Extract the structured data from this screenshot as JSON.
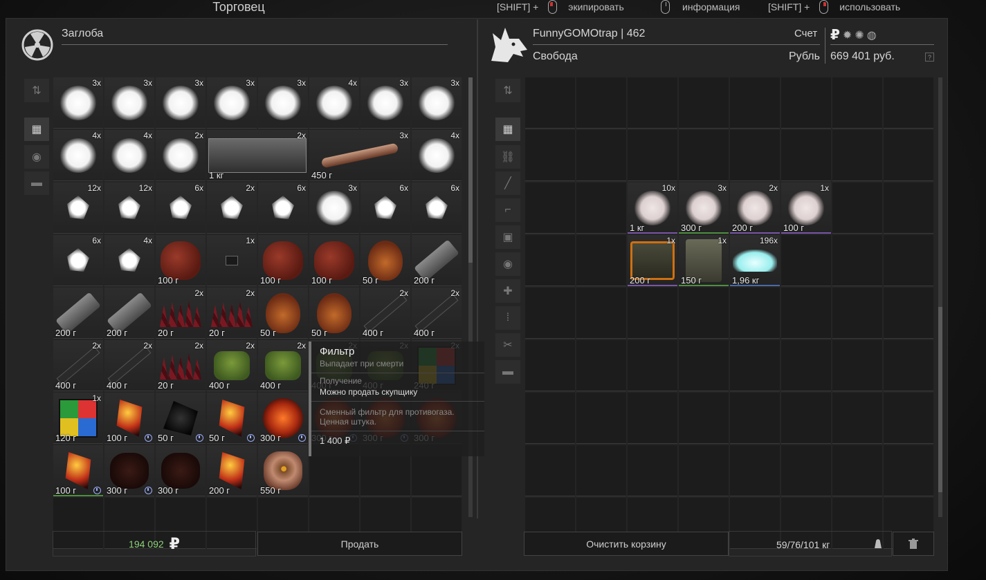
{
  "header": {
    "title": "Торговец",
    "hints": [
      {
        "modifier": "[SHIFT] +",
        "mouse": "left",
        "action": "экипировать"
      },
      {
        "modifier": "",
        "mouse": "plain",
        "action": "информация"
      },
      {
        "modifier": "[SHIFT] +",
        "mouse": "right",
        "action": "использовать"
      }
    ]
  },
  "trader": {
    "name": "Заглоба",
    "icon": "radiation-icon",
    "total": "194 092",
    "currency_symbol": "₽",
    "sell_label": "Продать",
    "tabs": [
      {
        "icon": "sort-icon",
        "glyph": "⇅"
      },
      {
        "icon": "grid-icon",
        "glyph": "▦"
      },
      {
        "icon": "artifact-icon",
        "glyph": "◉"
      },
      {
        "icon": "box-icon",
        "glyph": "▬"
      }
    ],
    "items": [
      {
        "type": "puff",
        "count": "3x"
      },
      {
        "type": "puff",
        "count": "3x"
      },
      {
        "type": "puff",
        "count": "3x"
      },
      {
        "type": "puff",
        "count": "3x"
      },
      {
        "type": "puff",
        "count": "3x"
      },
      {
        "type": "puff",
        "count": "4x"
      },
      {
        "type": "puff",
        "count": "3x"
      },
      {
        "type": "puff",
        "count": "3x"
      },
      {
        "type": "puff",
        "count": "4x"
      },
      {
        "type": "puff",
        "count": "4x"
      },
      {
        "type": "puff",
        "count": "2x"
      },
      {
        "type": "case",
        "count": "2x",
        "weight": "1 кг",
        "span": 2
      },
      {
        "type": "bone",
        "count": "3x",
        "weight": "450 г",
        "span": 2
      },
      {
        "type": "puff",
        "count": "4x"
      },
      {
        "type": "shard",
        "count": "12x"
      },
      {
        "type": "shard",
        "count": "12x"
      },
      {
        "type": "shard",
        "count": "6x"
      },
      {
        "type": "shard",
        "count": "2x"
      },
      {
        "type": "shard",
        "count": "6x"
      },
      {
        "type": "puff",
        "count": "3x"
      },
      {
        "type": "shard",
        "count": "6x"
      },
      {
        "type": "shard",
        "count": "6x"
      },
      {
        "type": "shard",
        "count": "6x"
      },
      {
        "type": "shard",
        "count": "4x"
      },
      {
        "type": "heart",
        "weight": "100 г"
      },
      {
        "type": "small-t",
        "count": "1x"
      },
      {
        "type": "heart",
        "weight": "100 г"
      },
      {
        "type": "heart",
        "weight": "100 г"
      },
      {
        "type": "sac",
        "weight": "50 г"
      },
      {
        "type": "tool",
        "weight": "200 г"
      },
      {
        "type": "tool",
        "weight": "200 г"
      },
      {
        "type": "tool",
        "weight": "200 г"
      },
      {
        "type": "spikes",
        "count": "2x",
        "weight": "20 г"
      },
      {
        "type": "spikes",
        "count": "2x",
        "weight": "20 г"
      },
      {
        "type": "sac",
        "weight": "50 г"
      },
      {
        "type": "sac",
        "weight": "50 г"
      },
      {
        "type": "stick",
        "count": "2x",
        "weight": "400 г"
      },
      {
        "type": "stick",
        "count": "2x",
        "weight": "400 г"
      },
      {
        "type": "stick",
        "count": "2x",
        "weight": "400 г"
      },
      {
        "type": "stick",
        "count": "2x",
        "weight": "400 г"
      },
      {
        "type": "spikes",
        "count": "2x",
        "weight": "20 г"
      },
      {
        "type": "can",
        "count": "2x",
        "weight": "400 г"
      },
      {
        "type": "can",
        "count": "2x",
        "weight": "400 г"
      },
      {
        "type": "can",
        "count": "2x",
        "weight": "400 г"
      },
      {
        "type": "can",
        "count": "2x",
        "weight": "400 г"
      },
      {
        "type": "cube",
        "count": "2x",
        "weight": "240 г"
      },
      {
        "type": "cube",
        "count": "1x",
        "weight": "120 г"
      },
      {
        "type": "gem",
        "weight": "100 г",
        "clock": true
      },
      {
        "type": "black",
        "weight": "50 г",
        "clock": true
      },
      {
        "type": "gem",
        "weight": "50 г",
        "clock": true
      },
      {
        "type": "redball",
        "weight": "300 г",
        "clock": true
      },
      {
        "type": "redball",
        "weight": "300 г",
        "clock": true
      },
      {
        "type": "redball",
        "weight": "300 г",
        "clock": true
      },
      {
        "type": "redball",
        "weight": "300 г",
        "clock": false
      },
      {
        "type": "gem",
        "weight": "100 г",
        "clock": true,
        "border": "green"
      },
      {
        "type": "rock",
        "weight": "300 г",
        "clock": true
      },
      {
        "type": "rock",
        "weight": "300 г"
      },
      {
        "type": "gem",
        "weight": "200 г"
      },
      {
        "type": "eye",
        "weight": "550 г"
      },
      {
        "type": "empty"
      },
      {
        "type": "empty"
      },
      {
        "type": "empty"
      },
      {
        "type": "empty"
      },
      {
        "type": "empty"
      },
      {
        "type": "empty"
      },
      {
        "type": "empty"
      },
      {
        "type": "empty"
      },
      {
        "type": "empty"
      },
      {
        "type": "empty"
      },
      {
        "type": "empty"
      }
    ]
  },
  "tooltip": {
    "title": "Фильтр",
    "drop": "Выпадает при смерти",
    "source_label": "Получение",
    "sellable": "Можно продать скупщику",
    "description": "Сменный фильтр для противогаза.\nЦенная штука.",
    "price": "1 400 ₽"
  },
  "player": {
    "name": "FunnyGOMOtrap | 462",
    "faction": "Свобода",
    "account_label": "Счет",
    "currency_label": "Рубль",
    "balance": "669 401 руб.",
    "help": "?",
    "icon": "wolf-icon",
    "currency_icons": [
      {
        "icon": "ruble-icon",
        "glyph": "₽"
      },
      {
        "icon": "cog-icon",
        "glyph": "✹"
      },
      {
        "icon": "gear-icon",
        "glyph": "✺"
      },
      {
        "icon": "compass-icon",
        "glyph": "◍"
      }
    ],
    "tabs": [
      {
        "icon": "sort-icon",
        "glyph": "⇅"
      },
      {
        "icon": "grid-icon",
        "glyph": "▦"
      },
      {
        "icon": "link-icon",
        "glyph": "⛓"
      },
      {
        "icon": "rifle-icon",
        "glyph": "╱"
      },
      {
        "icon": "pistol-icon",
        "glyph": "⌐"
      },
      {
        "icon": "armor-icon",
        "glyph": "▣"
      },
      {
        "icon": "artifact-icon",
        "glyph": "◉"
      },
      {
        "icon": "medkit-icon",
        "glyph": "✚"
      },
      {
        "icon": "ammo-icon",
        "glyph": "⁞"
      },
      {
        "icon": "tools-icon",
        "glyph": "✂"
      },
      {
        "icon": "box-icon",
        "glyph": "▬"
      }
    ],
    "items": [
      {
        "type": "puff-pink",
        "count": "10x",
        "weight": "1 кг",
        "border": "purple"
      },
      {
        "type": "puff-pink",
        "count": "3x",
        "weight": "300 г",
        "border": "green"
      },
      {
        "type": "puff-pink",
        "count": "2x",
        "weight": "200 г",
        "border": "purple"
      },
      {
        "type": "puff-pink",
        "count": "1x",
        "weight": "100 г",
        "border": "purple"
      },
      {
        "type": "device",
        "count": "1x",
        "weight": "200 г",
        "border": "purple"
      },
      {
        "type": "bricks",
        "count": "1x",
        "weight": "150 г",
        "border": "green"
      },
      {
        "type": "salt",
        "count": "196x",
        "weight": "1,96 кг",
        "border": "blue"
      }
    ],
    "clear_label": "Очистить корзину",
    "weight": "59/76/101 кг"
  }
}
